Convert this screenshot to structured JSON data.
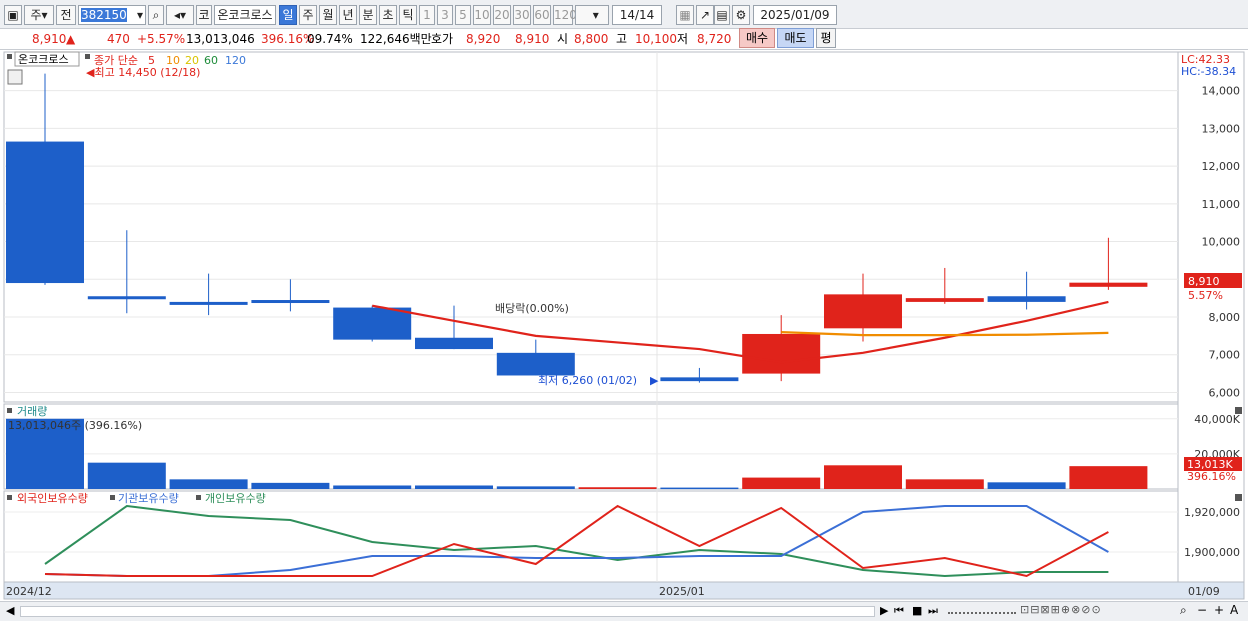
{
  "toolbar": {
    "tab_ju": "주",
    "tab_jeon": "전",
    "code": "382150",
    "sound_icon": "speaker-icon",
    "ko_btn": "코",
    "stock_name": "온코크로스",
    "periods": [
      "일",
      "주",
      "월",
      "년",
      "분",
      "초",
      "틱"
    ],
    "active_period": "일",
    "intervals": [
      "1",
      "3",
      "5",
      "10",
      "20",
      "30",
      "60",
      "120"
    ],
    "count": "14",
    "count_total": "14",
    "date": "2025/01/09"
  },
  "info": {
    "price": "8,910",
    "change": "470",
    "change_pct": "+5.57%",
    "volume": "13,013,046",
    "volume_pct": "396.16%",
    "turnover": "09.74%",
    "amount": "122,646백만",
    "quote_label": "호가",
    "bid": "8,920",
    "ask": "8,910",
    "open_label": "시",
    "open": "8,800",
    "high_label": "고",
    "high": "10,100",
    "low_label": "저",
    "low": "8,720",
    "buy_btn": "매수",
    "sell_btn": "매도",
    "avg_btn": "평"
  },
  "price_panel": {
    "stock_tag": "온코크로스",
    "ma_title": "종가 단순",
    "ma_periods": [
      "5",
      "10",
      "20",
      "60",
      "120"
    ],
    "high_note": "최고 14,450 (12/18)",
    "low_note": "최저 6,260 (01/02)",
    "dividend_note": "배당락(0.00%)",
    "lc": "LC:42.33",
    "hc": "HC:-38.34",
    "y_ticks": [
      "14,000",
      "13,000",
      "12,000",
      "11,000",
      "10,000",
      "9,000",
      "8,000",
      "7,000",
      "6,000"
    ],
    "current_price_tag": "8,910",
    "current_pct_tag": "5.57%"
  },
  "volume_panel": {
    "title": "거래량",
    "note": "13,013,046주 (396.16%)",
    "y_ticks": [
      "40,000K",
      "20,000K"
    ],
    "current_tag": "13,013K",
    "current_pct": "396.16%"
  },
  "holdings_panel": {
    "legend": [
      "외국인보유수량",
      "기관보유수량",
      "개인보유수량"
    ],
    "y_ticks": [
      "1,920,000",
      "1,900,000"
    ]
  },
  "x_axis": {
    "labels": [
      "2024/12",
      "2025/01"
    ],
    "right_label": "01/09"
  },
  "chart_data": {
    "type": "candlestick",
    "candles": [
      {
        "open": 8900,
        "close": 12650,
        "high": 14450,
        "low": 8850,
        "dir": "down"
      },
      {
        "open": 8550,
        "close": 8500,
        "high": 10300,
        "low": 8100,
        "dir": "down"
      },
      {
        "open": 8400,
        "close": 8350,
        "high": 9150,
        "low": 8050,
        "dir": "down"
      },
      {
        "open": 8450,
        "close": 8400,
        "high": 9000,
        "low": 8150,
        "dir": "down"
      },
      {
        "open": 8250,
        "close": 7400,
        "high": 8300,
        "low": 7350,
        "dir": "down"
      },
      {
        "open": 7450,
        "close": 7150,
        "high": 8300,
        "low": 7150,
        "dir": "down"
      },
      {
        "open": 7050,
        "close": 6450,
        "high": 7400,
        "low": 6450,
        "dir": "down"
      },
      {
        "open": 6400,
        "close": 6300,
        "high": 6650,
        "low": 6260,
        "dir": "down"
      },
      {
        "open": 6500,
        "close": 7550,
        "high": 8050,
        "low": 6300,
        "dir": "up"
      },
      {
        "open": 7700,
        "close": 8600,
        "high": 9150,
        "low": 7350,
        "dir": "up"
      },
      {
        "open": 8400,
        "close": 8500,
        "high": 9300,
        "low": 8350,
        "dir": "up"
      },
      {
        "open": 8400,
        "close": 8550,
        "high": 9200,
        "low": 8200,
        "dir": "down"
      },
      {
        "open": 8800,
        "close": 8910,
        "high": 10100,
        "low": 8720,
        "dir": "up"
      }
    ],
    "ma5": [
      null,
      null,
      null,
      null,
      8300,
      7900,
      7500,
      7150,
      6800,
      7050,
      7450,
      7900,
      8400
    ],
    "ma10": [
      null,
      null,
      null,
      null,
      null,
      null,
      null,
      null,
      7600,
      7520,
      7520,
      7530,
      7580
    ],
    "volume": [
      40000,
      15000,
      5500,
      3500,
      2000,
      2000,
      1500,
      1000,
      800,
      6500,
      13500,
      5500,
      3800,
      13013
    ],
    "volume_dir": [
      "down",
      "down",
      "down",
      "down",
      "down",
      "down",
      "down",
      "up",
      "down",
      "up",
      "up",
      "up",
      "down",
      "up"
    ],
    "foreign": [
      1889000,
      1888000,
      1888000,
      1888000,
      1888000,
      1904000,
      1894000,
      1923000,
      1903000,
      1922000,
      1892000,
      1897000,
      1888000,
      1910000
    ],
    "institution": [
      1889000,
      1888000,
      1888000,
      1891000,
      1898000,
      1898000,
      1897000,
      1897000,
      1898000,
      1898000,
      1920000,
      1923000,
      1923000,
      1900000
    ],
    "individual": [
      1894000,
      1923000,
      1918000,
      1916000,
      1905000,
      1901000,
      1903000,
      1896000,
      1901000,
      1899000,
      1891000,
      1888000,
      1890000,
      1890000
    ],
    "ylim_price": [
      5800,
      14600
    ],
    "ylim_volume": [
      0,
      45000
    ],
    "ylim_holdings": [
      1885000,
      1928000
    ]
  }
}
